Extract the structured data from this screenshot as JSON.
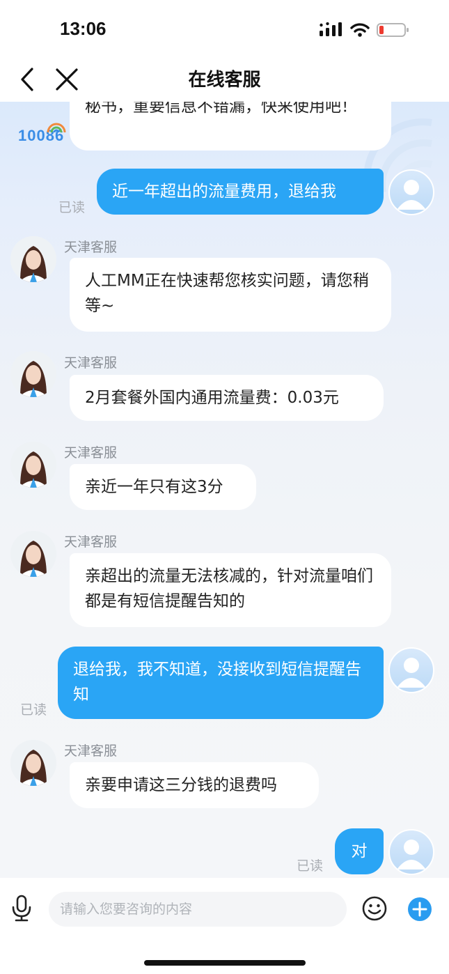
{
  "status_bar": {
    "time": "13:06"
  },
  "header": {
    "title": "在线客服"
  },
  "watermark": {
    "logo_text": "10086"
  },
  "messages": [
    {
      "from": "agent",
      "name": "",
      "text": "秘书，重要信息不错漏，快来使用吧！",
      "partial": true
    },
    {
      "from": "user",
      "text": "近一年超出的流量费用，退给我",
      "status": "已读"
    },
    {
      "from": "agent",
      "name": "天津客服",
      "text": "人工MM正在快速帮您核实问题，请您稍等~"
    },
    {
      "from": "agent",
      "name": "天津客服",
      "text": "2月套餐外国内通用流量费：0.03元"
    },
    {
      "from": "agent",
      "name": "天津客服",
      "text": "亲近一年只有这3分"
    },
    {
      "from": "agent",
      "name": "天津客服",
      "text": "亲超出的流量无法核减的，针对流量咱们都是有短信提醒告知的"
    },
    {
      "from": "user",
      "text": "退给我，我不知道，没接收到短信提醒告知",
      "status": "已读"
    },
    {
      "from": "agent",
      "name": "天津客服",
      "text": "亲要申请这三分钱的退费吗"
    },
    {
      "from": "user",
      "text": "对",
      "status": "已读"
    }
  ],
  "input": {
    "placeholder": "请输入您要咨询的内容"
  },
  "colors": {
    "user_bubble": "#2aa5f5",
    "agent_bubble": "#ffffff",
    "accent": "#2a9cf0"
  },
  "icons": [
    "back-icon",
    "close-icon",
    "microphone-icon",
    "emoji-icon",
    "plus-icon",
    "signal-icon",
    "wifi-icon",
    "battery-icon"
  ]
}
